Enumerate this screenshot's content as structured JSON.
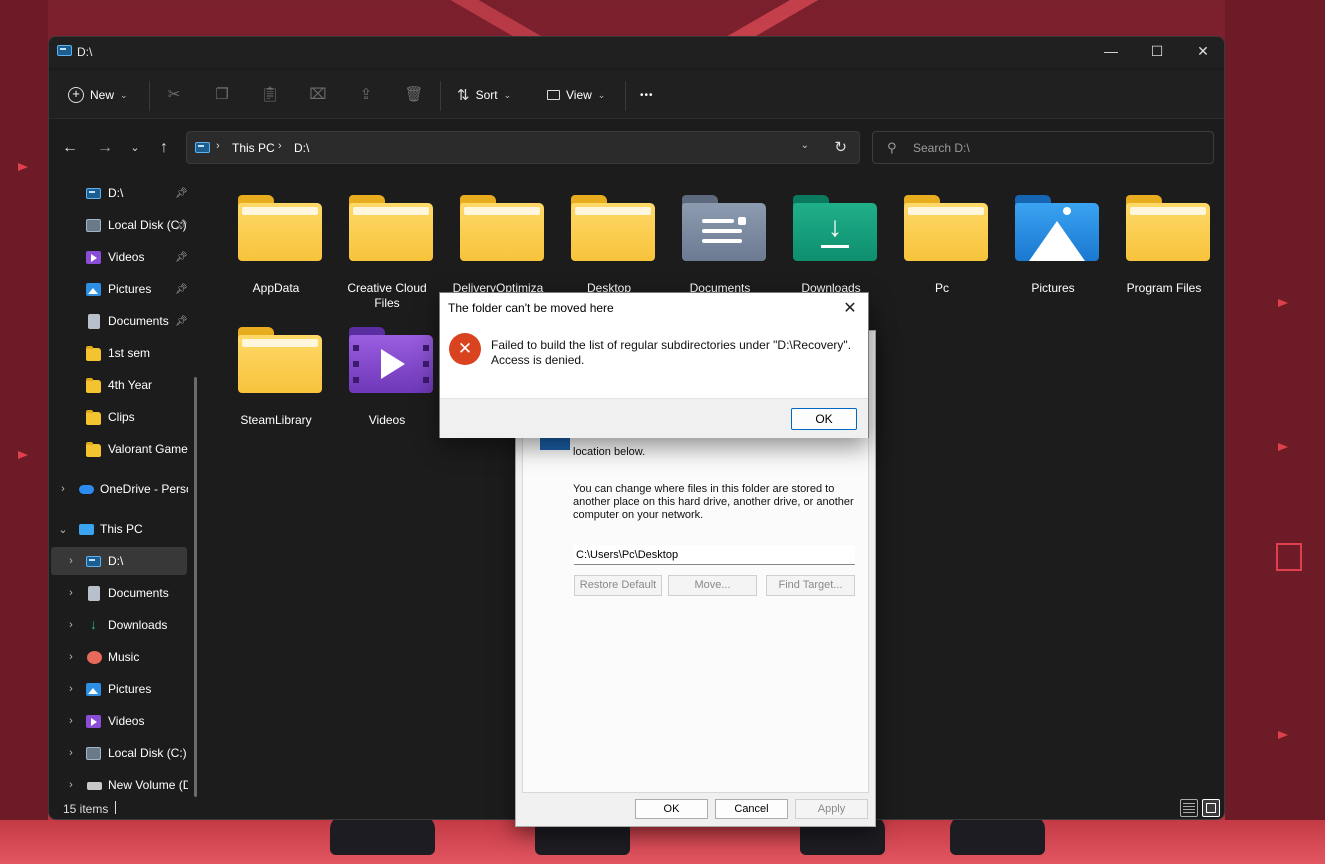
{
  "window": {
    "title": "D:\\",
    "controls": {
      "minimize": "—",
      "maximize": "☐",
      "close": "✕"
    }
  },
  "toolbar": {
    "new_label": "New",
    "sort_label": "Sort",
    "view_label": "View",
    "more_label": "•••"
  },
  "nav": {
    "breadcrumb": [
      "This PC",
      "D:\\"
    ],
    "search_placeholder": "Search D:\\"
  },
  "sidebar": {
    "quick_access": [
      {
        "label": "D:\\",
        "icon": "drive-icon",
        "pinned": true
      },
      {
        "label": "Local Disk (C:)",
        "icon": "local-disk-icon",
        "pinned": true
      },
      {
        "label": "Videos",
        "icon": "videos-icon",
        "pinned": true
      },
      {
        "label": "Pictures",
        "icon": "pictures-icon",
        "pinned": true
      },
      {
        "label": "Documents",
        "icon": "documents-icon",
        "pinned": true
      },
      {
        "label": "1st sem",
        "icon": "folder-icon",
        "pinned": false
      },
      {
        "label": "4th Year",
        "icon": "folder-icon",
        "pinned": false
      },
      {
        "label": "Clips",
        "icon": "folder-icon",
        "pinned": false
      },
      {
        "label": "Valorant Games",
        "icon": "folder-icon",
        "pinned": false
      }
    ],
    "onedrive": {
      "label": "OneDrive - Personal"
    },
    "this_pc": {
      "label": "This PC"
    },
    "this_pc_children": [
      {
        "label": "D:\\",
        "icon": "drive-icon",
        "selected": true
      },
      {
        "label": "Documents",
        "icon": "documents-icon"
      },
      {
        "label": "Downloads",
        "icon": "downloads-icon"
      },
      {
        "label": "Music",
        "icon": "music-icon"
      },
      {
        "label": "Pictures",
        "icon": "pictures-icon"
      },
      {
        "label": "Videos",
        "icon": "videos-icon"
      },
      {
        "label": "Local Disk (C:)",
        "icon": "local-disk-icon"
      },
      {
        "label": "New Volume (D:)",
        "icon": "volume-icon"
      }
    ]
  },
  "folders": [
    {
      "name": "AppData",
      "type": "plain"
    },
    {
      "name": "Creative Cloud Files",
      "type": "plain"
    },
    {
      "name": "DeliveryOptimiza",
      "type": "plain"
    },
    {
      "name": "Desktop",
      "type": "plain"
    },
    {
      "name": "Documents",
      "type": "docs"
    },
    {
      "name": "Downloads",
      "type": "dl"
    },
    {
      "name": "Pc",
      "type": "plain"
    },
    {
      "name": "Pictures",
      "type": "pics"
    },
    {
      "name": "Program Files",
      "type": "plain"
    },
    {
      "name": "SteamLibrary",
      "type": "plain"
    },
    {
      "name": "Videos",
      "type": "vid"
    }
  ],
  "status": {
    "item_count": "15 items"
  },
  "properties_dialog": {
    "text_location": "location below.",
    "text_change": "You can change where files in this folder are stored to another place on this hard drive, another drive, or another computer on your network.",
    "path_value": "C:\\Users\\Pc\\Desktop",
    "restore_default": "Restore Default",
    "move": "Move...",
    "find_target": "Find Target...",
    "ok": "OK",
    "cancel": "Cancel",
    "apply": "Apply"
  },
  "error_dialog": {
    "title": "The folder can't be moved here",
    "message": "Failed to build the list of regular subdirectories under \"D:\\Recovery\". Access is denied.",
    "ok": "OK",
    "close": "✕",
    "icon_glyph": "✕"
  },
  "colors": {
    "accent": "#0067c0",
    "error_red": "#d9431f",
    "folder_yellow": "#f7c33b",
    "window_bg": "#1c1c1c"
  }
}
